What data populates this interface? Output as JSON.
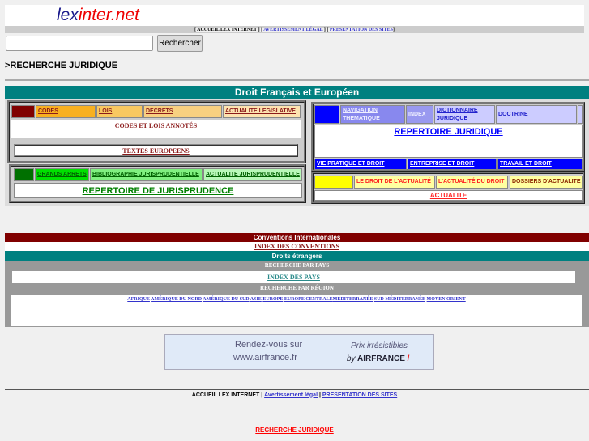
{
  "logo": {
    "part1": "lex",
    "part2": "inter.net"
  },
  "topnav": {
    "home": "[ ACCUEIL LEX INTERNET ] [",
    "legal": "AVERTISSEMENT LÉGAL",
    "sep": "] [",
    "presentation": "PRESENTATION DES SITES",
    "end": "]"
  },
  "search": {
    "value": "",
    "button": "Rechercher"
  },
  "breadcrumb": ">RECHERCHE JURIDIQUE",
  "section_title": "Droit Français et Européen",
  "legislation": {
    "tabs": [
      "CODES",
      "LOIS",
      "DECRETS",
      "ACTUALITE LEGISLATIVE"
    ],
    "main": "CODES ET LOIS ANNOTÉS",
    "euro": "TEXTES  EUROPEENS"
  },
  "jurisprudence": {
    "tabs": [
      "GRANDS  ARRETS",
      "BIBLIOGRAPHIE  JURISPRUDENTIELLE",
      "ACTUALITE JURISPRUDENTIELLE"
    ],
    "main": "REPERTOIRE DE JURISPRUDENCE"
  },
  "repertoire": {
    "tabs": [
      "NAVIGATION THEMATIQUE",
      "INDEX",
      "DICTIONNAIRE JURIDIQUE",
      "DOCTRINE"
    ],
    "main": "REPERTOIRE JURIDIQUE",
    "bottom": [
      "VIE PRATIQUE ET DROIT",
      "ENTREPRISE ET DROIT",
      "TRAVAIL ET DROIT"
    ]
  },
  "actualite": {
    "tabs": [
      "LE DROIT DE L'ACTUALITÉ",
      "L'ACTUALITÉ DU DROIT",
      "DOSSIERS D'ACTUALITE"
    ],
    "main": "ACTUALITE"
  },
  "conventions": {
    "title": "Conventions Internationales",
    "index": "INDEX DES CONVENTIONS"
  },
  "foreign": {
    "title": "Droits étrangers",
    "by_country": "RECHERCHE PAR PAYS",
    "country_index": "INDEX DES PAYS",
    "by_region": "RECHERCHE PAR RÉGION",
    "regions": [
      "AFRIQUE",
      "AMÉRIQUE DU NORD",
      "AMÉRIQUE DU SUD",
      "ASIE",
      "EUROPE",
      "EUROPE CENTRALE",
      "MÉDITERRANÉE",
      "SUD MÉDITERRANÉE",
      "MOYEN ORIENT"
    ]
  },
  "ad": {
    "line1": "Rendez-vous sur",
    "line2": "www.airfrance.fr",
    "tag": "Prix irrésistibles",
    "by": "by",
    "brand": "AIRFRANCE"
  },
  "footer": {
    "home": "ACCUEIL LEX INTERNET",
    "sep1": " | ",
    "legal": "Avertissement légal",
    "sep2": " | ",
    "presentation": "PRESENTATION DES SITES",
    "bottom_link": "RECHERCHE JURIDIQUE"
  }
}
